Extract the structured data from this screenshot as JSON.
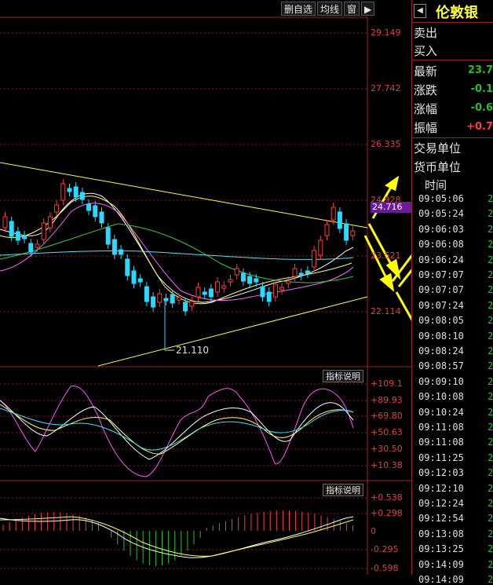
{
  "toolbar": {
    "items": [
      "删自选",
      "均线",
      "窗"
    ]
  },
  "main_chart": {
    "price_axis": [
      "29.149",
      "27.742",
      "26.335",
      "24.928",
      "23.521",
      "22.114"
    ],
    "current_price_tag": "24.716",
    "low_marker": "21.110"
  },
  "indicator1": {
    "button": "指标说明",
    "axis": [
      "+109.1",
      "+89.93",
      "+69.80",
      "+50.63",
      "+30.50",
      "+10.38"
    ]
  },
  "indicator2": {
    "button": "指标说明",
    "axis": [
      "+0.538",
      "+0.298",
      "0",
      "-0.295",
      "-0.598"
    ]
  },
  "quote_panel": {
    "stock_name": "伦敦银",
    "rows": [
      {
        "label": "卖出",
        "value": ""
      },
      {
        "label": "买入",
        "value": ""
      },
      {
        "label": "最新",
        "value": "23.7"
      },
      {
        "label": "涨跌",
        "value": "-0.1"
      },
      {
        "label": "涨幅",
        "value": "-0.6"
      },
      {
        "label": "振幅",
        "value": "+0.7"
      },
      {
        "label": "交易单位",
        "value": ""
      },
      {
        "label": "货币单位",
        "value": ""
      }
    ],
    "time_header": "时间",
    "times": [
      "09:05:06",
      "09:05:24",
      "09:06:03",
      "09:06:08",
      "09:06:24",
      "09:07:07",
      "09:07:07",
      "09:07:24",
      "09:08:05",
      "09:08:10",
      "09:08:24",
      "09:08:57",
      "09:09:10",
      "09:10:08",
      "09:10:24",
      "09:11:08",
      "09:11:08",
      "09:11:25",
      "09:12:03",
      "09:12:10",
      "09:12:24",
      "09:12:54",
      "09:13:08",
      "09:13:25",
      "09:14:09",
      "09:14:09"
    ],
    "time_value": "2"
  },
  "colors": {
    "up": "#ff3b3b",
    "down": "#2bd8ff",
    "green": "#22c02a",
    "yellow": "#ffff00"
  }
}
